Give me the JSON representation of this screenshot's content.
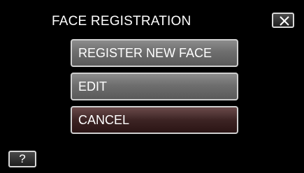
{
  "title": "FACE REGISTRATION",
  "menu": {
    "register_label": "REGISTER NEW FACE",
    "edit_label": "EDIT",
    "cancel_label": "CANCEL"
  },
  "help_label": "?",
  "icons": {
    "close": "close-icon"
  },
  "colors": {
    "background": "#000000",
    "button": "#7a7a7a",
    "selected_button": "#3d2424",
    "border": "#cfcfcf",
    "text": "#ffffff"
  }
}
